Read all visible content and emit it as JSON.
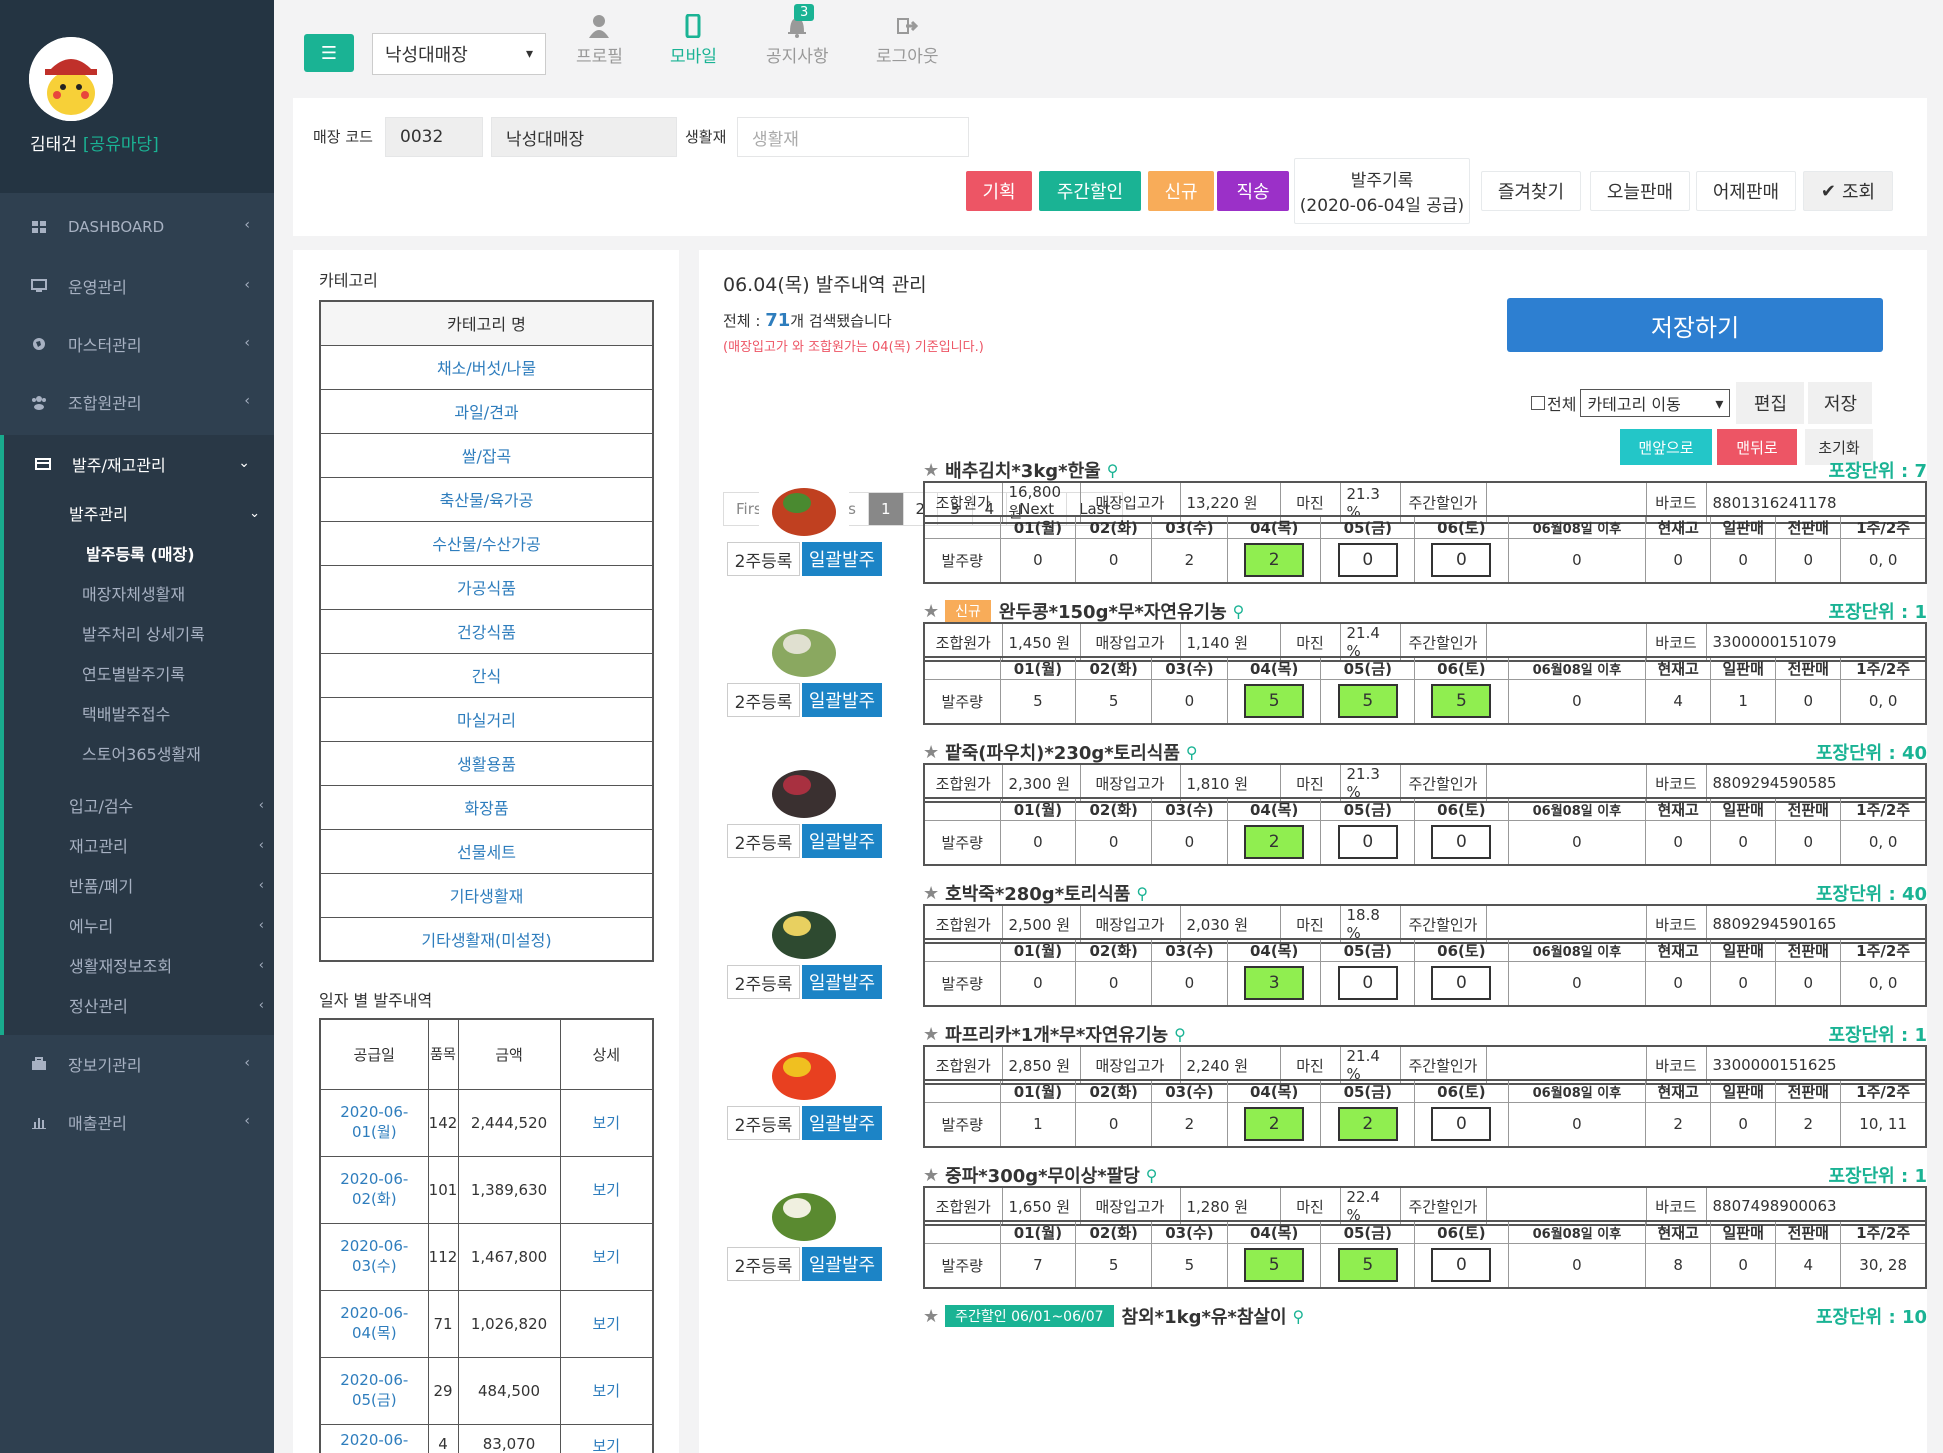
{
  "sidebar": {
    "user_name": "김태건",
    "user_role": "[공유마당]",
    "menu": [
      {
        "label": "DASHBOARD"
      },
      {
        "label": "운영관리"
      },
      {
        "label": "마스터관리"
      },
      {
        "label": "조합원관리"
      },
      {
        "label": "발주/재고관리"
      },
      {
        "label": "장보기관리"
      },
      {
        "label": "매출관리"
      }
    ],
    "submenu": {
      "group": "발주관리",
      "items": [
        "발주등록 (매장)",
        "매장자체생활재",
        "발주처리 상세기록",
        "연도별발주기록",
        "택배발주접수",
        "스토어365생활재"
      ],
      "others": [
        "입고/검수",
        "재고관리",
        "반품/폐기",
        "에누리",
        "생활재정보조회",
        "정산관리"
      ]
    }
  },
  "topbar": {
    "store": "낙성대매장",
    "nav": [
      {
        "label": "프로필"
      },
      {
        "label": "모바일"
      },
      {
        "label": "공지사항"
      },
      {
        "label": "로그아웃"
      }
    ],
    "notice_count": "3"
  },
  "filter": {
    "store_code_label": "매장 코드",
    "store_code": "0032",
    "store_name": "낙성대매장",
    "item_label": "생활재",
    "item_placeholder": "생활재",
    "buttons": [
      "기획",
      "주간할인",
      "신규",
      "직송"
    ],
    "history_line1": "발주기록",
    "history_line2": "(2020-06-04일 공급)",
    "buttons2": [
      "즐겨찾기",
      "오늘판매",
      "어제판매",
      "조회"
    ],
    "colors": {
      "plan": "#ed5565",
      "weekly": "#1ab394",
      "new": "#f8ac59",
      "direct": "#9b30c8"
    }
  },
  "category": {
    "title": "카테고리",
    "header": "카테고리 명",
    "items": [
      "채소/버섯/나물",
      "과일/견과",
      "쌀/잡곡",
      "축산물/육가공",
      "수산물/수산가공",
      "가공식품",
      "건강식품",
      "간식",
      "마실거리",
      "생활용품",
      "화장품",
      "선물세트",
      "기타생활재",
      "기타생활재(미설정)"
    ]
  },
  "orders_by_date": {
    "title": "일자 별 발주내역",
    "headers": [
      "공급일",
      "품목",
      "금액",
      "상세"
    ],
    "rows": [
      {
        "date": "2020-06-01(월)",
        "count": "142",
        "amount": "2,444,520",
        "detail": "보기"
      },
      {
        "date": "2020-06-02(화)",
        "count": "101",
        "amount": "1,389,630",
        "detail": "보기"
      },
      {
        "date": "2020-06-03(수)",
        "count": "112",
        "amount": "1,467,800",
        "detail": "보기"
      },
      {
        "date": "2020-06-04(목)",
        "count": "71",
        "amount": "1,026,820",
        "detail": "보기"
      },
      {
        "date": "2020-06-05(금)",
        "count": "29",
        "amount": "484,500",
        "detail": "보기"
      },
      {
        "date": "2020-06-",
        "count": "4",
        "amount": "83,070",
        "detail": "보기"
      }
    ]
  },
  "main": {
    "title": "06.04(목) 발주내역 관리",
    "count_prefix": "전체 : ",
    "count": "71",
    "count_suffix": "개 검색됐습니다",
    "note": "(매장입고가 와 조합원가는 04(목) 기준입니다.)",
    "save_label": "저장하기",
    "all_label": "전체",
    "category_move": "카테고리 이동",
    "edit_label": "편집",
    "save_small": "저장",
    "front_label": "맨앞으로",
    "back_label": "맨뒤로",
    "reset_label": "초기화",
    "pager": [
      "First",
      "Previous",
      "1",
      "2",
      "3",
      "4",
      "Next",
      "Last"
    ],
    "reg_label": "2주등록",
    "bulk_label": "일괄발주",
    "info_headers": [
      "조합원가",
      "매장입고가",
      "마진",
      "주간할인가",
      "바코드"
    ],
    "order_headers": [
      "01(월)",
      "02(화)",
      "03(수)",
      "04(목)",
      "05(금)",
      "06(토)",
      "06월08일 이후",
      "현재고",
      "일판매",
      "전판매",
      "1주/2주"
    ],
    "order_row_label": "발주량"
  },
  "products": [
    {
      "name": "배추김치*3kg*한울",
      "tag": "",
      "unit": "포장단위 : 7",
      "member_price": "16,800 원",
      "store_price": "13,220 원",
      "margin": "21.3 %",
      "weekly_price": "",
      "barcode": "8801316241178",
      "q": [
        "0",
        "0",
        "2",
        "2",
        "0",
        "0",
        "0",
        "0",
        "0",
        "0",
        "0, 0"
      ]
    },
    {
      "name": "완두콩*150g*무*자연유기농",
      "tag": "신규",
      "unit": "포장단위 : 1",
      "member_price": "1,450 원",
      "store_price": "1,140 원",
      "margin": "21.4 %",
      "weekly_price": "",
      "barcode": "3300000151079",
      "q": [
        "5",
        "5",
        "0",
        "5",
        "5",
        "5",
        "0",
        "4",
        "1",
        "0",
        "0, 0"
      ]
    },
    {
      "name": "팥죽(파우치)*230g*토리식품",
      "tag": "",
      "unit": "포장단위 : 40",
      "member_price": "2,300 원",
      "store_price": "1,810 원",
      "margin": "21.3 %",
      "weekly_price": "",
      "barcode": "8809294590585",
      "q": [
        "0",
        "0",
        "0",
        "2",
        "0",
        "0",
        "0",
        "0",
        "0",
        "0",
        "0, 0"
      ]
    },
    {
      "name": "호박죽*280g*토리식품",
      "tag": "",
      "unit": "포장단위 : 40",
      "member_price": "2,500 원",
      "store_price": "2,030 원",
      "margin": "18.8 %",
      "weekly_price": "",
      "barcode": "8809294590165",
      "q": [
        "0",
        "0",
        "0",
        "3",
        "0",
        "0",
        "0",
        "0",
        "0",
        "0",
        "0, 0"
      ]
    },
    {
      "name": "파프리카*1개*무*자연유기농",
      "tag": "",
      "unit": "포장단위 : 1",
      "member_price": "2,850 원",
      "store_price": "2,240 원",
      "margin": "21.4 %",
      "weekly_price": "",
      "barcode": "3300000151625",
      "q": [
        "1",
        "0",
        "2",
        "2",
        "2",
        "0",
        "0",
        "2",
        "0",
        "2",
        "10, 11"
      ]
    },
    {
      "name": "중파*300g*무이상*팔당",
      "tag": "",
      "unit": "포장단위 : 1",
      "member_price": "1,650 원",
      "store_price": "1,280 원",
      "margin": "22.4 %",
      "weekly_price": "",
      "barcode": "8807498900063",
      "q": [
        "7",
        "5",
        "5",
        "5",
        "5",
        "0",
        "0",
        "8",
        "0",
        "4",
        "30, 28"
      ]
    },
    {
      "name": "참외*1kg*유*참살이",
      "tag": "주간할인 06/01~06/07",
      "unit": "포장단위 : 10",
      "member_price": "",
      "store_price": "",
      "margin": "",
      "weekly_price": "",
      "barcode": "",
      "q": []
    }
  ]
}
